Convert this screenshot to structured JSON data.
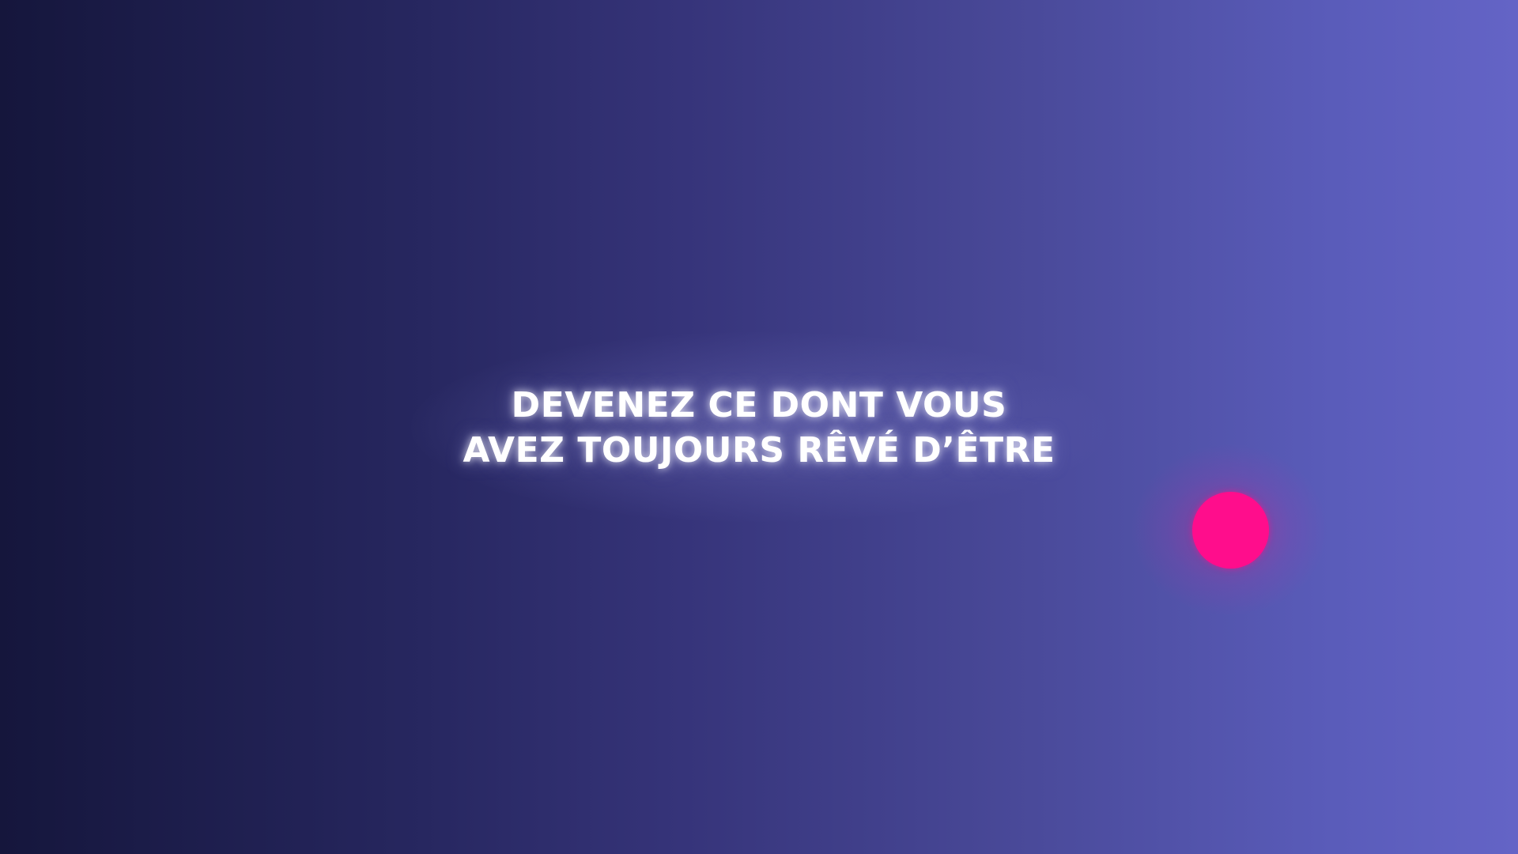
{
  "headline": {
    "line1": "DEVENEZ CE DONT VOUS",
    "line2": "AVEZ TOUJOURS RÊVÉ D’ÊTRE"
  },
  "colors": {
    "background_left": "#15163c",
    "background_right": "#6464c6",
    "text": "#ffffff",
    "dot": "#ff0d8c"
  },
  "decorations": {
    "dot_icon": "pink-circle"
  }
}
